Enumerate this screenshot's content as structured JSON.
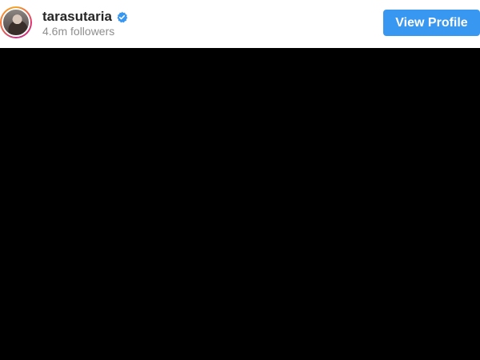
{
  "header": {
    "username": "tarasutaria",
    "verified": true,
    "verified_icon": "verified-check-icon",
    "followers": "4.6m followers",
    "view_profile_label": "View Profile",
    "avatar": "profile-avatar"
  },
  "colors": {
    "button_blue": "#3897f0",
    "verified_blue": "#3897f0",
    "username_text": "#262626",
    "secondary_text": "#8e8e8e",
    "media_background": "#000000"
  }
}
